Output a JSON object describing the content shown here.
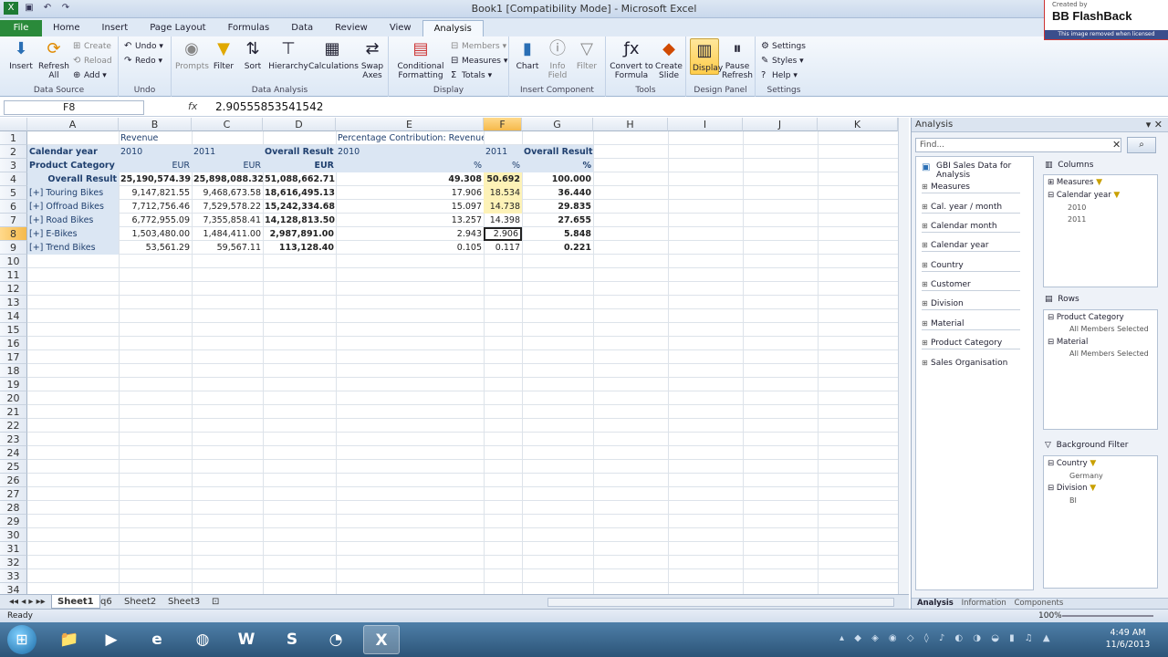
{
  "titlebar": {
    "title": "Book1  [Compatibility Mode]  -  Microsoft Excel",
    "watermark_created": "Created by",
    "watermark_brand": "BB FlashBack",
    "watermark_note": "This image removed when licensed"
  },
  "tabs": [
    "File",
    "Home",
    "Insert",
    "Page Layout",
    "Formulas",
    "Data",
    "Review",
    "View",
    "Analysis"
  ],
  "ribbon": {
    "data_source": {
      "label": "Data Source",
      "insert": "Insert",
      "refresh_all": "Refresh All",
      "create": "Create",
      "reload": "Reload",
      "add": "Add"
    },
    "undo": {
      "label": "Undo",
      "undo": "Undo",
      "redo": "Redo"
    },
    "data_analysis": {
      "label": "Data Analysis",
      "prompts": "Prompts",
      "filter": "Filter",
      "sort": "Sort",
      "hierarchy": "Hierarchy",
      "calculations": "Calculations",
      "swap_axes": "Swap Axes"
    },
    "display": {
      "label": "Display",
      "conditional_formatting": "Conditional Formatting",
      "members": "Members",
      "measures": "Measures",
      "totals": "Totals"
    },
    "insert_component": {
      "label": "Insert Component",
      "chart": "Chart",
      "info_field": "Info Field",
      "filter": "Filter"
    },
    "tools": {
      "label": "Tools",
      "convert": "Convert to Formula",
      "create_slide": "Create Slide"
    },
    "design_panel": {
      "label": "Design Panel",
      "display": "Display",
      "pause_refresh": "Pause Refresh"
    },
    "settings": {
      "label": "Settings",
      "settings": "Settings",
      "styles": "Styles",
      "help": "Help"
    }
  },
  "formula_bar": {
    "name_box": "F8",
    "fx": "fx",
    "value": "2.90555853541542"
  },
  "columns": [
    "A",
    "B",
    "C",
    "D",
    "E",
    "F",
    "G",
    "H",
    "I",
    "J",
    "K"
  ],
  "rows": [
    "1",
    "2",
    "3",
    "4",
    "5",
    "6",
    "7",
    "8",
    "9",
    "10",
    "11",
    "12",
    "13",
    "14",
    "15",
    "16",
    "17",
    "18",
    "19",
    "20",
    "21",
    "22",
    "23",
    "24",
    "25",
    "26",
    "27",
    "28",
    "29",
    "30",
    "31",
    "32",
    "33",
    "34"
  ],
  "sheet": {
    "r1": {
      "b": "Revenue",
      "e": "Percentage Contribution: Revenue"
    },
    "r2": {
      "a": "Calendar year",
      "b": "2010",
      "c": "2011",
      "d": "Overall Result",
      "e": "2010",
      "f": "2011",
      "g": "Overall Result"
    },
    "r3": {
      "a": "Product Category",
      "b": "EUR",
      "c": "EUR",
      "d": "EUR",
      "e": "%",
      "f": "%",
      "g": "%"
    },
    "data": [
      {
        "a": "Overall Result",
        "b": "25,190,574.39",
        "c": "25,898,088.32",
        "d": "51,088,662.71",
        "e": "49.308",
        "f": "50.692",
        "g": "100.000"
      },
      {
        "a": "[+] Touring Bikes",
        "b": "9,147,821.55",
        "c": "9,468,673.58",
        "d": "18,616,495.13",
        "e": "17.906",
        "f": "18.534",
        "g": "36.440"
      },
      {
        "a": "[+] Offroad Bikes",
        "b": "7,712,756.46",
        "c": "7,529,578.22",
        "d": "15,242,334.68",
        "e": "15.097",
        "f": "14.738",
        "g": "29.835"
      },
      {
        "a": "[+] Road Bikes",
        "b": "6,772,955.09",
        "c": "7,355,858.41",
        "d": "14,128,813.50",
        "e": "13.257",
        "f": "14.398",
        "g": "27.655"
      },
      {
        "a": "[+] E-Bikes",
        "b": "1,503,480.00",
        "c": "1,484,411.00",
        "d": "2,987,891.00",
        "e": "2.943",
        "f": "2.906",
        "g": "5.848"
      },
      {
        "a": "[+] Trend Bikes",
        "b": "53,561.29",
        "c": "59,567.11",
        "d": "113,128.40",
        "e": "0.105",
        "f": "0.117",
        "g": "0.221"
      }
    ]
  },
  "sheet_tabs": [
    "Sheet1",
    "q6",
    "Sheet2",
    "Sheet3"
  ],
  "pane": {
    "title": "Analysis",
    "find_placeholder": "Find...",
    "data_source": "GBI Sales Data for Analysis",
    "dimensions": [
      "Measures",
      "Cal. year / month",
      "Calendar month",
      "Calendar year",
      "Country",
      "Customer",
      "Division",
      "Material",
      "Product Category",
      "Sales Organisation"
    ],
    "columns_title": "Columns",
    "columns": {
      "measures": "Measures",
      "calendar_year": "Calendar year",
      "y2010": "2010",
      "y2011": "2011"
    },
    "rows_title": "Rows",
    "rows": {
      "product_category": "Product Category",
      "all1": "All Members Selected",
      "material": "Material",
      "all2": "All Members Selected"
    },
    "bg_title": "Background Filter",
    "bg": {
      "country": "Country",
      "germany": "Germany",
      "division": "Division",
      "bi": "BI"
    },
    "tabs": [
      "Analysis",
      "Information",
      "Components"
    ]
  },
  "status": {
    "ready": "Ready",
    "zoom": "100%"
  },
  "taskbar": {
    "time": "4:49 AM",
    "date": "11/6/2013"
  }
}
